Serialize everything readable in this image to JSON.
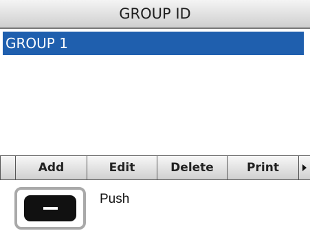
{
  "screen": {
    "title": "GROUP ID",
    "list": {
      "items": [
        {
          "label": "GROUP 1",
          "selected": true
        }
      ]
    },
    "softkeys": {
      "add": "Add",
      "edit": "Edit",
      "delete": "Delete",
      "print": "Print"
    },
    "more_icon": "triangle-right-icon"
  },
  "instruction": {
    "key_icon": "minus-key-icon",
    "label": "Push"
  },
  "colors": {
    "selection": "#1f5fae",
    "key": "#111111",
    "key_frame": "#a9a9a9"
  }
}
